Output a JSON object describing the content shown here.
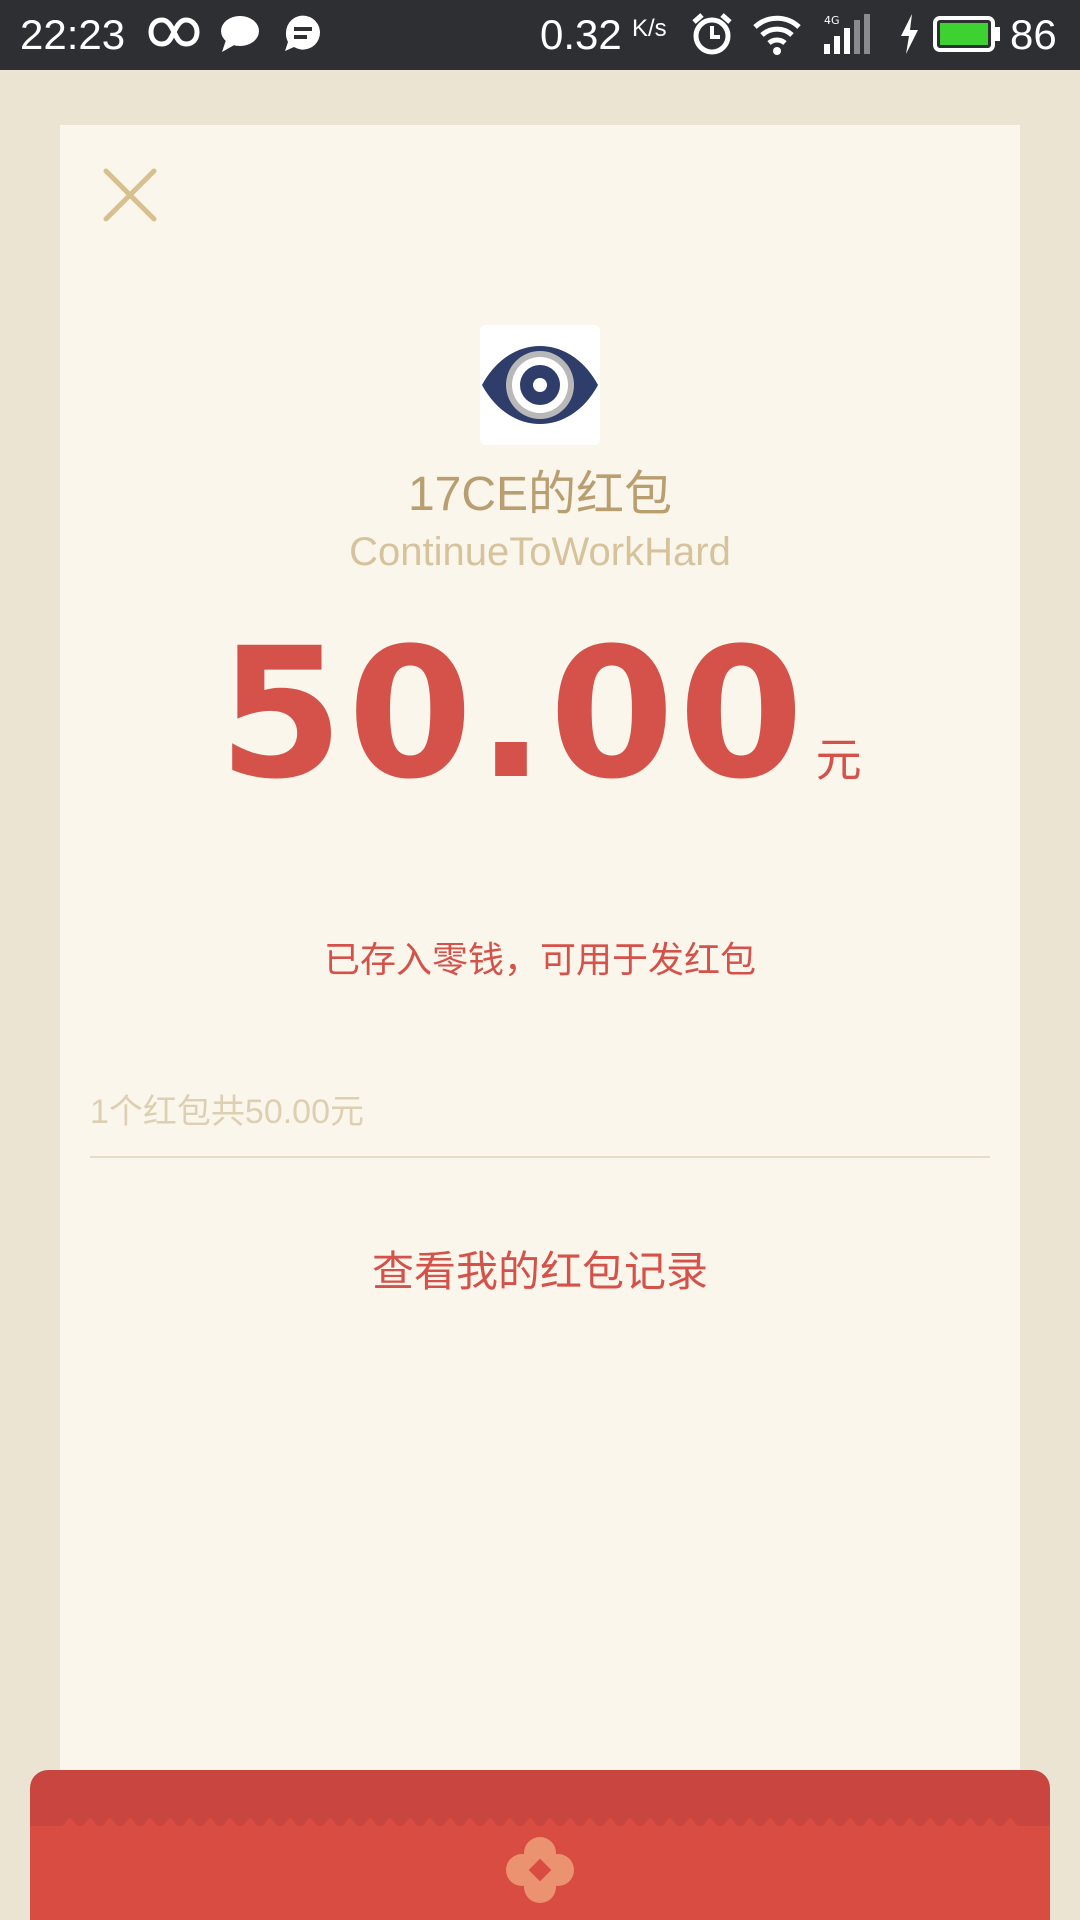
{
  "status_bar": {
    "time": "22:23",
    "net_speed": "0.32",
    "net_unit": "K/s",
    "battery": "86",
    "icons": [
      "infinity-icon",
      "chat-bubble-icon",
      "message-icon",
      "alarm-icon",
      "wifi-icon",
      "signal-4g-icon",
      "charging-icon",
      "battery-icon"
    ]
  },
  "red_packet": {
    "sender_title": "17CE的红包",
    "wish": "ContinueToWorkHard",
    "amount": "50.00",
    "currency": "元",
    "saved_note": "已存入零钱，可用于发红包",
    "summary": "1个红包共50.00元",
    "records_link": "查看我的红包记录"
  },
  "colors": {
    "status_bar_bg": "#2e2f33",
    "page_bg": "#ece4d3",
    "card_bg": "#faf6ec",
    "accent_red": "#d4524a",
    "gold_text": "#b99f70",
    "battery_green": "#3ed132"
  }
}
